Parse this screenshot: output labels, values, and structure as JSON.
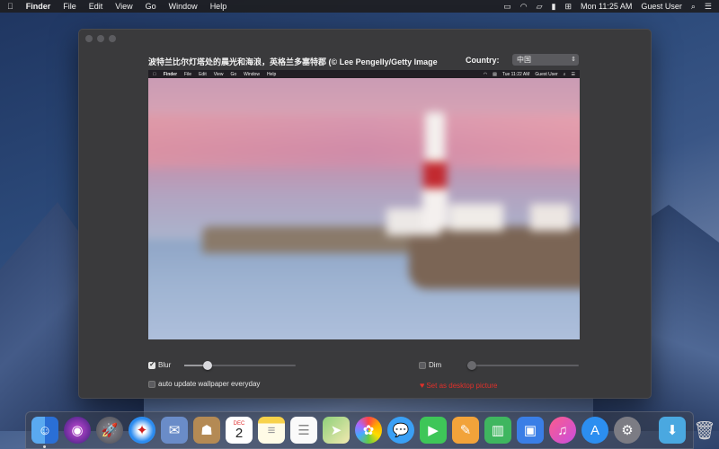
{
  "menubar": {
    "apple": "",
    "app_name": "Finder",
    "menus": [
      "File",
      "Edit",
      "View",
      "Go",
      "Window",
      "Help"
    ],
    "clock": "Mon 11:25 AM",
    "user": "Guest User"
  },
  "window": {
    "caption": "波特兰比尔灯塔处的晨光和海浪，英格兰多塞特郡 (© Lee Pengelly/Getty Image",
    "country_label": "Country:",
    "country_value": "中国"
  },
  "preview": {
    "menubar": {
      "app_name": "Finder",
      "menus": [
        "File",
        "Edit",
        "View",
        "Go",
        "Window",
        "Help"
      ],
      "clock": "Tue 11:22 AM",
      "user": "Guest User"
    }
  },
  "controls": {
    "blur": {
      "label": "Blur",
      "checked": true,
      "slider_value": 0.18
    },
    "dim": {
      "label": "Dim",
      "checked": false,
      "slider_value": 0.0
    },
    "auto_update": {
      "label": "auto update wallpaper everyday",
      "checked": false
    },
    "set_desktop": "Set as desktop picture"
  },
  "dock": {
    "apps": [
      "finder-icon",
      "siri-icon",
      "launchpad-icon",
      "safari-icon",
      "mail-stamp-icon",
      "contacts-icon",
      "calendar-icon",
      "notes-icon",
      "reminders-icon",
      "maps-icon",
      "photos-icon",
      "messages-icon",
      "facetime-icon",
      "pages-icon",
      "numbers-icon",
      "keynote-icon",
      "itunes-icon",
      "app-store-icon",
      "system-preferences-icon"
    ],
    "calendar_month": "DEC",
    "calendar_day": "2",
    "extras": [
      "downloads-folder-icon",
      "trash-icon"
    ]
  }
}
